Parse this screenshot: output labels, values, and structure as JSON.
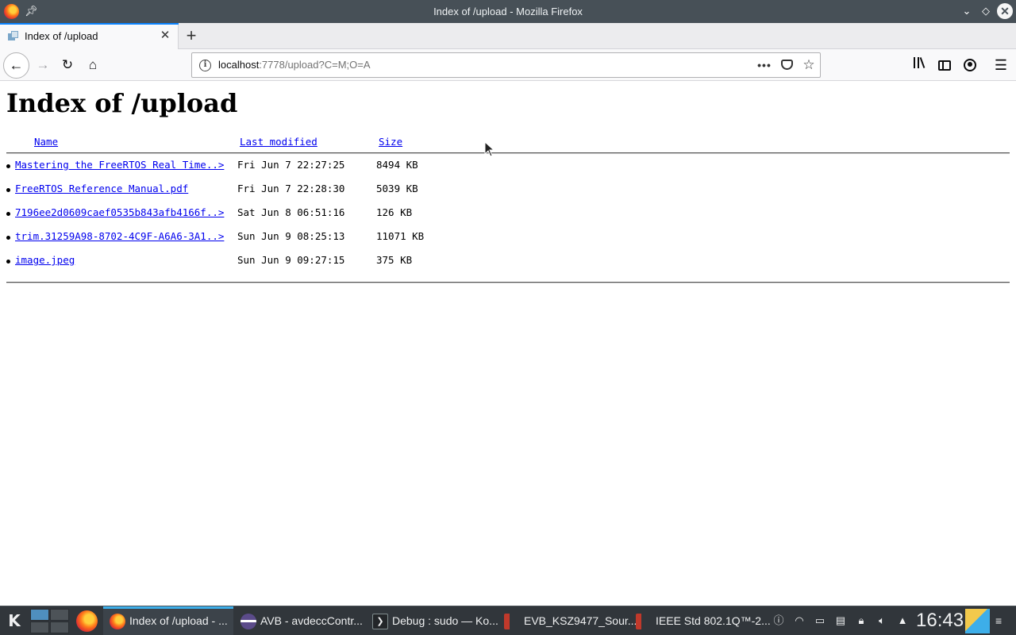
{
  "window": {
    "title": "Index of /upload - Mozilla Firefox"
  },
  "tabs": [
    {
      "label": "Index of /upload",
      "active": true
    }
  ],
  "navbar": {
    "url_host": "localhost",
    "url_rest": ":7778/upload?C=M;O=A"
  },
  "page": {
    "heading": "Index of /upload",
    "columns": {
      "name": "Name",
      "modified": "Last modified",
      "size": "Size"
    },
    "files": [
      {
        "name": "Mastering the FreeRTOS Real Time..>",
        "modified": "Fri Jun  7 22:27:25",
        "size": "8494 KB"
      },
      {
        "name": "FreeRTOS Reference Manual.pdf",
        "modified": "Fri Jun  7 22:28:30",
        "size": "5039 KB"
      },
      {
        "name": "7196ee2d0609caef0535b843afb4166f..>",
        "modified": "Sat Jun  8 06:51:16",
        "size": "126 KB"
      },
      {
        "name": "trim.31259A98-8702-4C9F-A6A6-3A1..>",
        "modified": "Sun Jun  9 08:25:13",
        "size": "11071 KB"
      },
      {
        "name": "image.jpeg",
        "modified": "Sun Jun  9 09:27:15",
        "size": "375 KB"
      }
    ]
  },
  "taskbar": {
    "tasks": [
      {
        "label": "Index of /upload - ...",
        "icon": "firefox-icon",
        "active": true
      },
      {
        "label": "AVB - avdeccContr...",
        "icon": "app-icon",
        "active": false
      },
      {
        "label": "Debug : sudo — Ko...",
        "icon": "terminal-icon",
        "active": false
      },
      {
        "label": "EVB_KSZ9477_Sour...",
        "icon": "pdf-icon",
        "active": false
      },
      {
        "label": "IEEE Std 802.1Q™-2...",
        "icon": "pdf-icon",
        "active": false
      }
    ],
    "clock": "16:43"
  },
  "colors": {
    "titlebar": "#475057",
    "tab_accent": "#0a84ff",
    "link": "#0000ee",
    "taskbar": "#31363b",
    "taskbar_accent": "#3daee9"
  }
}
